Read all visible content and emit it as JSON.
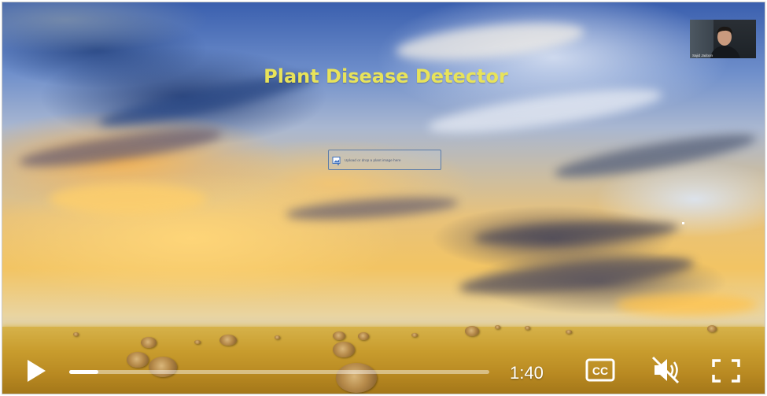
{
  "video": {
    "title": "Plant Disease Detector",
    "upload_text": "Upload or drop a plant image here",
    "webcam_name": "Sajid Jadoon",
    "time": "1:40",
    "progress": 0.07
  },
  "controls": {
    "cc_label": "CC"
  },
  "icons": {
    "play": "play-icon",
    "cc": "closed-captions-icon",
    "mute": "muted-speaker-icon",
    "fullscreen": "fullscreen-icon",
    "upload": "upload-image-icon"
  },
  "colors": {
    "title": "#e8e35a",
    "controls": "#ffffff"
  }
}
